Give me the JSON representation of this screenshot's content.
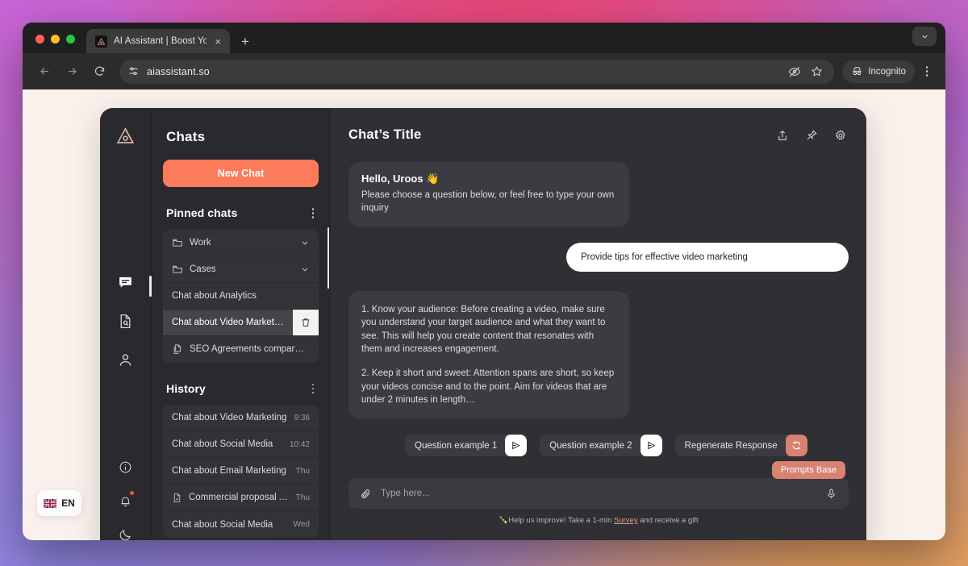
{
  "browser": {
    "tab": {
      "title": "AI Assistant | Boost Your Prod",
      "favicon": "triangle-eye-icon",
      "close": "×"
    },
    "new_tab_label": "+",
    "window_chevron": "chevron-down-icon",
    "url": "aiassistant.so",
    "profile_label": "Incognito",
    "nav": {
      "back": "back-arrow-icon",
      "forward": "forward-arrow-icon",
      "reload": "reload-icon"
    },
    "omni_icons": [
      "tune-icon",
      "eye-off-icon",
      "star-icon"
    ],
    "menu": "kebab-menu-icon"
  },
  "page": {
    "language_badge": {
      "flag": "uk-flag",
      "label": "EN"
    }
  },
  "rail": {
    "logo": "triangle-eye-logo",
    "items": [
      {
        "name": "chats",
        "icon": "chat-bubble-icon",
        "active": true
      },
      {
        "name": "documents",
        "icon": "document-search-icon",
        "active": false
      },
      {
        "name": "profile",
        "icon": "user-icon",
        "active": false
      }
    ],
    "bottom_items": [
      {
        "name": "info",
        "icon": "info-circle-icon",
        "badge": false
      },
      {
        "name": "notifications",
        "icon": "bell-icon",
        "badge": true
      },
      {
        "name": "theme",
        "icon": "moon-icon",
        "badge": false
      }
    ],
    "expand": "›"
  },
  "sidebar": {
    "title": "Chats",
    "new_chat_label": "New Chat",
    "pinned": {
      "heading": "Pinned chats",
      "menu": "kebab-menu-icon",
      "items": [
        {
          "label": "Work",
          "icon": "folder-icon",
          "trailing": "chevron-down-icon",
          "selected": false
        },
        {
          "label": "Cases",
          "icon": "folder-icon",
          "trailing": "chevron-down-icon",
          "selected": false
        },
        {
          "label": "Chat about Analytics",
          "icon": null,
          "trailing": null,
          "selected": false
        },
        {
          "label": "Chat about Video Market…",
          "icon": null,
          "trailing": "trash-icon",
          "selected": true
        },
        {
          "label": "SEO Agreements compar…",
          "icon": "docs-icon",
          "trailing": null,
          "selected": false
        }
      ]
    },
    "history": {
      "heading": "History",
      "menu": "kebab-menu-icon",
      "items": [
        {
          "label": "Chat about Video Marketing",
          "icon": null,
          "time": "9:36"
        },
        {
          "label": "Chat about Social Media",
          "icon": null,
          "time": "10:42"
        },
        {
          "label": "Chat about Email Marketing",
          "icon": null,
          "time": "Thu"
        },
        {
          "label": "Commercial proposal Ag…",
          "icon": "file-icon",
          "time": "Thu"
        },
        {
          "label": "Chat about Social Media",
          "icon": null,
          "time": "Wed"
        }
      ]
    },
    "collapse": "‹"
  },
  "chat": {
    "title": "Chat’s Title",
    "actions": [
      {
        "name": "share",
        "icon": "share-icon"
      },
      {
        "name": "pin",
        "icon": "pin-icon"
      },
      {
        "name": "settings",
        "icon": "gear-icon"
      }
    ],
    "greeting": {
      "title": "Hello, Uroos 👋",
      "text": "Please choose a question below, or feel free to type your own inquiry"
    },
    "user_message": "Provide tips for effective video marketing",
    "assistant_message": {
      "p1": "1. Know your audience: Before creating a video, make sure you understand your target audience and what they want to see. This will help you create content that resonates with them and increases engagement.",
      "p2": "2. Keep it short and sweet: Attention spans are short, so keep your videos concise and to the point. Aim for videos that are under 2 minutes in length…"
    },
    "suggestions": [
      {
        "label": "Question example 1",
        "action_icon": "send-icon",
        "style": "default"
      },
      {
        "label": "Question example 2",
        "action_icon": "send-icon",
        "style": "default"
      },
      {
        "label": "Regenerate Response",
        "action_icon": "refresh-icon",
        "style": "accent"
      }
    ],
    "prompts_tooltip": "Prompts Base",
    "composer": {
      "attach_icon": "paperclip-icon",
      "placeholder": "Type here...",
      "mic_icon": "microphone-icon"
    },
    "footnote": {
      "emoji": "🍾",
      "before": "Help us improve! Take a 1-min ",
      "link": "Survey",
      "after": " and receive a gift"
    },
    "collapse": "‹"
  },
  "colors": {
    "accent": "#fb7b5b",
    "accent_soft": "#d88272",
    "panel": "#2a2a2e",
    "chat_panel": "#2f2f34",
    "bubble": "#3b3b41",
    "notification_dot": "#f0503c"
  }
}
